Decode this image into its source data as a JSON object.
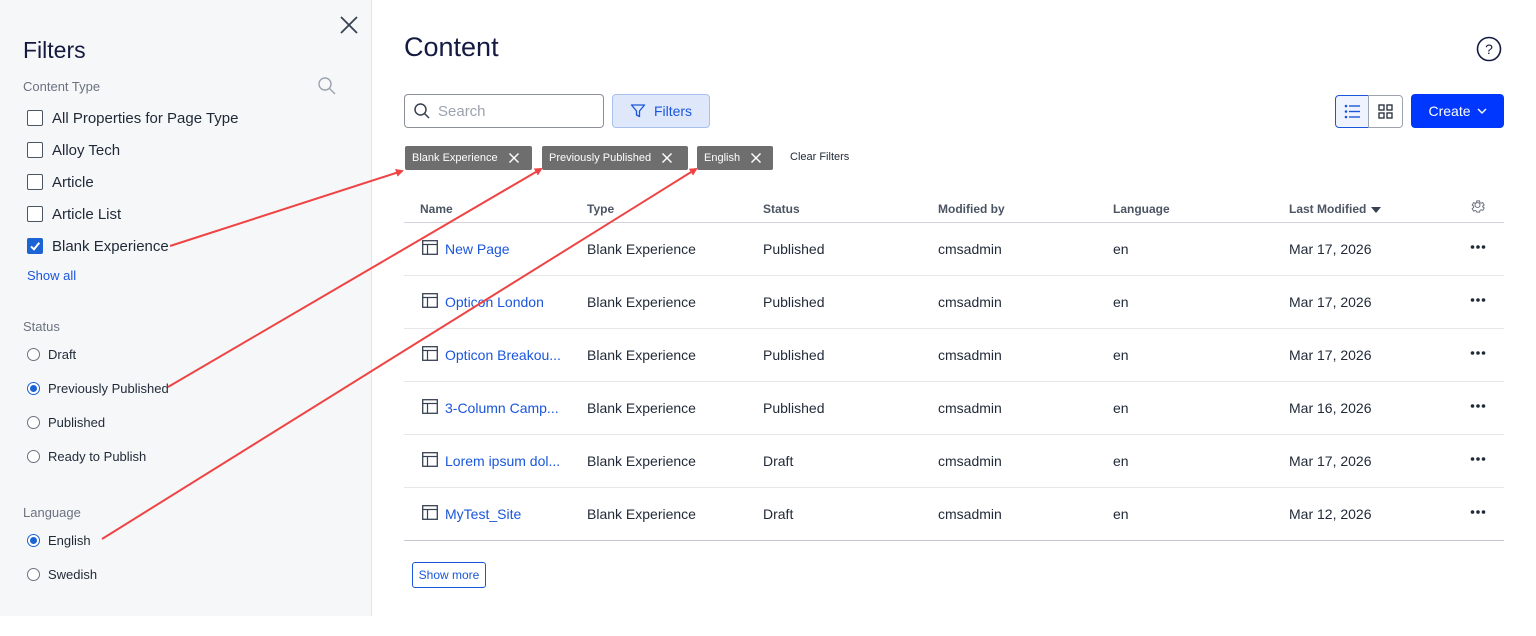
{
  "sidebar": {
    "title": "Filters",
    "content_type": {
      "label": "Content Type",
      "items": [
        {
          "label": "All Properties for Page Type",
          "checked": false
        },
        {
          "label": "Alloy Tech",
          "checked": false
        },
        {
          "label": "Article",
          "checked": false
        },
        {
          "label": "Article List",
          "checked": false
        },
        {
          "label": "Blank Experience",
          "checked": true
        }
      ],
      "show_all": "Show all"
    },
    "status": {
      "label": "Status",
      "items": [
        {
          "label": "Draft",
          "checked": false
        },
        {
          "label": "Previously Published",
          "checked": true
        },
        {
          "label": "Published",
          "checked": false
        },
        {
          "label": "Ready to Publish",
          "checked": false
        }
      ]
    },
    "language": {
      "label": "Language",
      "items": [
        {
          "label": "English",
          "checked": true
        },
        {
          "label": "Swedish",
          "checked": false
        }
      ]
    }
  },
  "main": {
    "title": "Content",
    "search_placeholder": "Search",
    "filters_label": "Filters",
    "create_label": "Create",
    "chips": [
      "Blank Experience",
      "Previously Published",
      "English"
    ],
    "clear_filters": "Clear Filters",
    "columns": [
      "Name",
      "Type",
      "Status",
      "Modified by",
      "Language",
      "Last Modified"
    ],
    "rows": [
      {
        "name": "New Page",
        "type": "Blank Experience",
        "status": "Published",
        "modified_by": "cmsadmin",
        "language": "en",
        "last_modified": "Mar 17, 2026"
      },
      {
        "name": "Opticon London",
        "type": "Blank Experience",
        "status": "Published",
        "modified_by": "cmsadmin",
        "language": "en",
        "last_modified": "Mar 17, 2026"
      },
      {
        "name": "Opticon Breakou...",
        "type": "Blank Experience",
        "status": "Published",
        "modified_by": "cmsadmin",
        "language": "en",
        "last_modified": "Mar 17, 2026"
      },
      {
        "name": "3-Column Camp...",
        "type": "Blank Experience",
        "status": "Published",
        "modified_by": "cmsadmin",
        "language": "en",
        "last_modified": "Mar 16, 2026"
      },
      {
        "name": "Lorem ipsum dol...",
        "type": "Blank Experience",
        "status": "Draft",
        "modified_by": "cmsadmin",
        "language": "en",
        "last_modified": "Mar 17, 2026"
      },
      {
        "name": "MyTest_Site",
        "type": "Blank Experience",
        "status": "Draft",
        "modified_by": "cmsadmin",
        "language": "en",
        "last_modified": "Mar 12, 2026"
      }
    ],
    "show_more": "Show more"
  },
  "colors": {
    "accent": "#1a56db",
    "primary_button": "#0037ff",
    "chip_bg": "#6e6e6e",
    "annotation_arrow": "#ef4444",
    "sidebar_bg": "#f6f7f9"
  },
  "icons": {
    "close": "close-icon",
    "search": "search-icon",
    "help": "help-icon",
    "filter": "filter-icon",
    "list_view": "list-view-icon",
    "grid_view": "grid-view-icon",
    "settings": "gear-icon",
    "row_type": "page-layout-icon",
    "row_menu": "more-options-icon"
  }
}
